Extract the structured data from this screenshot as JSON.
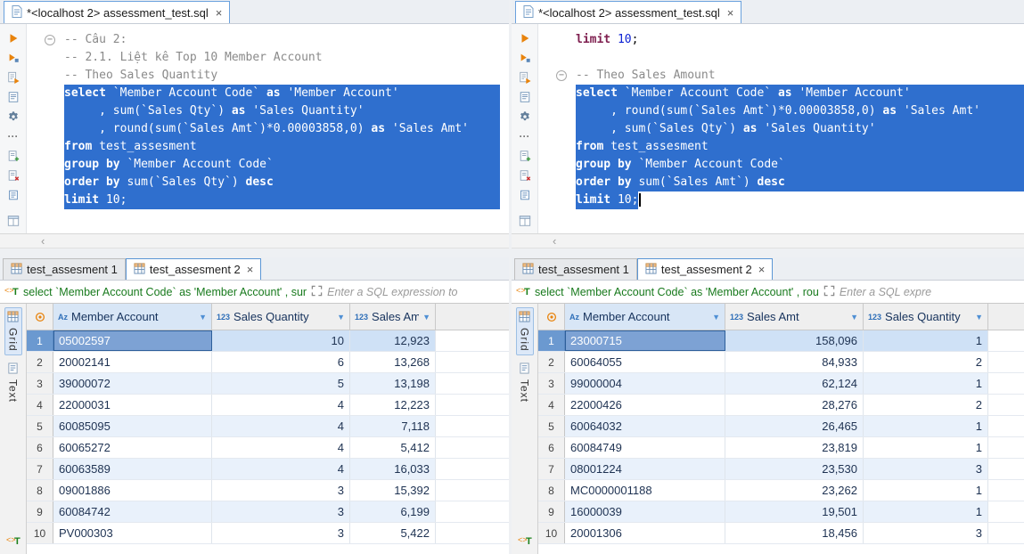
{
  "ui": {
    "close": "×",
    "scroll_left": "‹",
    "dropdown": "▼",
    "fold": "−",
    "dots": "···",
    "toolbar_icon_names": [
      "execute-statement-icon",
      "execute-new-tab-icon",
      "execute-script-icon",
      "explain-plan-icon",
      "settings-gear-icon",
      "more-actions-icon",
      "new-script-icon",
      "delete-script-icon",
      "open-script-icon",
      "split-view-icon"
    ],
    "accent_colors": {
      "selection_blue": "#2f6fce",
      "selected_cell": "#7da2d4",
      "alt_row": "#e9f1fb",
      "filter_green": "#187a1d",
      "keyword_maroon": "#7f2050"
    }
  },
  "panels": [
    {
      "tab_title": "*<localhost 2> assessment_test.sql",
      "editor_lines": [
        {
          "fold": true,
          "sel": false,
          "tokens": [
            {
              "t": "-- Câu 2:",
              "c": "com"
            }
          ]
        },
        {
          "sel": false,
          "tokens": [
            {
              "t": "-- 2.1. Liệt kê Top 10 Member Account",
              "c": "com"
            }
          ]
        },
        {
          "sel": false,
          "tokens": [
            {
              "t": "-- Theo Sales Quantity",
              "c": "com"
            }
          ]
        },
        {
          "sel": true,
          "tokens": [
            {
              "t": "select ",
              "c": "kw"
            },
            {
              "t": "`Member Account Code` ",
              "c": "id"
            },
            {
              "t": "as ",
              "c": "kw"
            },
            {
              "t": "'Member Account'",
              "c": "str"
            }
          ]
        },
        {
          "sel": true,
          "tokens": [
            {
              "t": "     , sum(",
              "c": "pln"
            },
            {
              "t": "`Sales Qty`",
              "c": "id"
            },
            {
              "t": ") ",
              "c": "pln"
            },
            {
              "t": "as ",
              "c": "kw"
            },
            {
              "t": "'Sales Quantity'",
              "c": "str"
            }
          ]
        },
        {
          "sel": true,
          "tokens": [
            {
              "t": "     , round(sum(",
              "c": "pln"
            },
            {
              "t": "`Sales Amt`",
              "c": "id"
            },
            {
              "t": ")*0.00003858,0) ",
              "c": "pln"
            },
            {
              "t": "as ",
              "c": "kw"
            },
            {
              "t": "'Sales Amt'",
              "c": "str"
            }
          ]
        },
        {
          "sel": true,
          "tokens": [
            {
              "t": "from ",
              "c": "kw"
            },
            {
              "t": "test_assesment",
              "c": "pln"
            }
          ]
        },
        {
          "sel": true,
          "tokens": [
            {
              "t": "group by ",
              "c": "kw"
            },
            {
              "t": "`Member Account Code`",
              "c": "id"
            }
          ]
        },
        {
          "sel": true,
          "tokens": [
            {
              "t": "order by ",
              "c": "kw"
            },
            {
              "t": "sum(",
              "c": "pln"
            },
            {
              "t": "`Sales Qty`",
              "c": "id"
            },
            {
              "t": ") ",
              "c": "pln"
            },
            {
              "t": "desc",
              "c": "kw"
            }
          ]
        },
        {
          "sel": true,
          "tokens": [
            {
              "t": "limit ",
              "c": "kw"
            },
            {
              "t": "10",
              "c": "num"
            },
            {
              "t": ";",
              "c": "pln"
            }
          ]
        }
      ],
      "result_tabs": {
        "tab1": "test_assesment 1",
        "tab2": "test_assesment 2"
      },
      "filter_query": "select `Member Account Code` as 'Member Account' , sur",
      "filter_placeholder": "Enter a SQL expression to",
      "side_tabs": {
        "grid": "Grid",
        "text": "Text"
      },
      "columns": [
        {
          "type": "Az",
          "label": "Member Account"
        },
        {
          "type": "123",
          "label": "Sales Quantity"
        },
        {
          "type": "123",
          "label": "Sales Amt"
        }
      ],
      "rows": [
        {
          "num": "1",
          "c0": "05002597",
          "c1": "10",
          "c2": "12,923"
        },
        {
          "num": "2",
          "c0": "20002141",
          "c1": "6",
          "c2": "13,268"
        },
        {
          "num": "3",
          "c0": "39000072",
          "c1": "5",
          "c2": "13,198"
        },
        {
          "num": "4",
          "c0": "22000031",
          "c1": "4",
          "c2": "12,223"
        },
        {
          "num": "5",
          "c0": "60085095",
          "c1": "4",
          "c2": "7,118"
        },
        {
          "num": "6",
          "c0": "60065272",
          "c1": "4",
          "c2": "5,412"
        },
        {
          "num": "7",
          "c0": "60063589",
          "c1": "4",
          "c2": "16,033"
        },
        {
          "num": "8",
          "c0": "09001886",
          "c1": "3",
          "c2": "15,392"
        },
        {
          "num": "9",
          "c0": "60084742",
          "c1": "3",
          "c2": "6,199"
        },
        {
          "num": "10",
          "c0": "PV000303",
          "c1": "3",
          "c2": "5,422"
        }
      ]
    },
    {
      "tab_title": "*<localhost 2> assessment_test.sql",
      "editor_lines": [
        {
          "sel": false,
          "tokens": [
            {
              "t": "limit ",
              "c": "kw"
            },
            {
              "t": "10",
              "c": "num"
            },
            {
              "t": ";",
              "c": "pln"
            }
          ]
        },
        {
          "sel": false,
          "tokens": []
        },
        {
          "fold": true,
          "sel": false,
          "tokens": [
            {
              "t": "-- Theo Sales Amount",
              "c": "com"
            }
          ]
        },
        {
          "sel": true,
          "tokens": [
            {
              "t": "select ",
              "c": "kw"
            },
            {
              "t": "`Member Account Code` ",
              "c": "id"
            },
            {
              "t": "as ",
              "c": "kw"
            },
            {
              "t": "'Member Account'",
              "c": "str"
            }
          ]
        },
        {
          "sel": true,
          "tokens": [
            {
              "t": "     , round(sum(",
              "c": "pln"
            },
            {
              "t": "`Sales Amt`",
              "c": "id"
            },
            {
              "t": ")*0.00003858,0) ",
              "c": "pln"
            },
            {
              "t": "as ",
              "c": "kw"
            },
            {
              "t": "'Sales Amt'",
              "c": "str"
            }
          ]
        },
        {
          "sel": true,
          "tokens": [
            {
              "t": "     , sum(",
              "c": "pln"
            },
            {
              "t": "`Sales Qty`",
              "c": "id"
            },
            {
              "t": ") ",
              "c": "pln"
            },
            {
              "t": "as ",
              "c": "kw"
            },
            {
              "t": "'Sales Quantity'",
              "c": "str"
            }
          ]
        },
        {
          "sel": true,
          "tokens": [
            {
              "t": "from ",
              "c": "kw"
            },
            {
              "t": "test_assesment",
              "c": "pln"
            }
          ]
        },
        {
          "sel": true,
          "tokens": [
            {
              "t": "group by ",
              "c": "kw"
            },
            {
              "t": "`Member Account Code`",
              "c": "id"
            }
          ]
        },
        {
          "sel": true,
          "tokens": [
            {
              "t": "order by ",
              "c": "kw"
            },
            {
              "t": "sum(",
              "c": "pln"
            },
            {
              "t": "`Sales Amt`",
              "c": "id"
            },
            {
              "t": ") ",
              "c": "pln"
            },
            {
              "t": "desc",
              "c": "kw"
            }
          ]
        },
        {
          "sel": true,
          "short": true,
          "caret": true,
          "tokens": [
            {
              "t": "limit ",
              "c": "kw"
            },
            {
              "t": "10",
              "c": "num"
            },
            {
              "t": ";",
              "c": "pln"
            }
          ]
        }
      ],
      "result_tabs": {
        "tab1": "test_assesment 1",
        "tab2": "test_assesment 2"
      },
      "filter_query": "select `Member Account Code` as 'Member Account' , rou",
      "filter_placeholder": "Enter a SQL expre",
      "side_tabs": {
        "grid": "Grid",
        "text": "Text"
      },
      "columns": [
        {
          "type": "Az",
          "label": "Member Account"
        },
        {
          "type": "123",
          "label": "Sales Amt"
        },
        {
          "type": "123",
          "label": "Sales Quantity"
        }
      ],
      "rows": [
        {
          "num": "1",
          "c0": "23000715",
          "c1": "158,096",
          "c2": "1"
        },
        {
          "num": "2",
          "c0": "60064055",
          "c1": "84,933",
          "c2": "2"
        },
        {
          "num": "3",
          "c0": "99000004",
          "c1": "62,124",
          "c2": "1"
        },
        {
          "num": "4",
          "c0": "22000426",
          "c1": "28,276",
          "c2": "2"
        },
        {
          "num": "5",
          "c0": "60064032",
          "c1": "26,465",
          "c2": "1"
        },
        {
          "num": "6",
          "c0": "60084749",
          "c1": "23,819",
          "c2": "1"
        },
        {
          "num": "7",
          "c0": "08001224",
          "c1": "23,530",
          "c2": "3"
        },
        {
          "num": "8",
          "c0": "MC0000001188",
          "c1": "23,262",
          "c2": "1"
        },
        {
          "num": "9",
          "c0": "16000039",
          "c1": "19,501",
          "c2": "1"
        },
        {
          "num": "10",
          "c0": "20001306",
          "c1": "18,456",
          "c2": "3"
        }
      ]
    }
  ]
}
